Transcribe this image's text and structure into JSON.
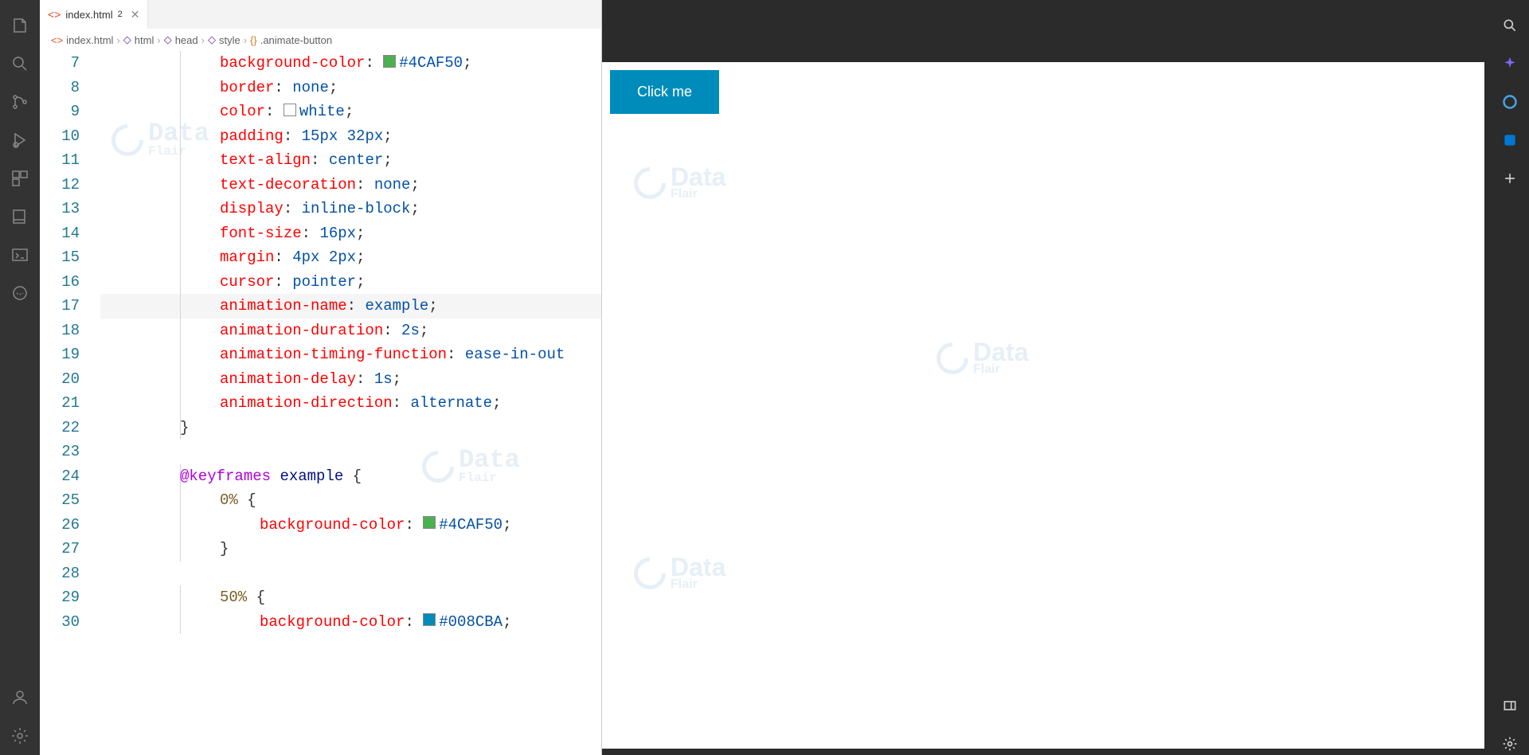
{
  "tab": {
    "filename": "index.html",
    "modified_marker": "2"
  },
  "breadcrumbs": [
    "index.html",
    "html",
    "head",
    "style",
    ".animate-button"
  ],
  "line_start": 7,
  "line_end": 30,
  "highlighted_line": 17,
  "code_lines": [
    {
      "n": 7,
      "indent": 6,
      "tokens": [
        [
          "prop",
          "background-color"
        ],
        [
          "punct",
          ": "
        ],
        [
          "swatch",
          "#4CAF50"
        ],
        [
          "val",
          "#4CAF50"
        ],
        [
          "punct",
          ";"
        ]
      ]
    },
    {
      "n": 8,
      "indent": 6,
      "tokens": [
        [
          "prop",
          "border"
        ],
        [
          "punct",
          ": "
        ],
        [
          "val",
          "none"
        ],
        [
          "punct",
          ";"
        ]
      ]
    },
    {
      "n": 9,
      "indent": 6,
      "tokens": [
        [
          "prop",
          "color"
        ],
        [
          "punct",
          ": "
        ],
        [
          "swatch",
          "#ffffff"
        ],
        [
          "val",
          "white"
        ],
        [
          "punct",
          ";"
        ]
      ]
    },
    {
      "n": 10,
      "indent": 6,
      "tokens": [
        [
          "prop",
          "padding"
        ],
        [
          "punct",
          ": "
        ],
        [
          "val",
          "15px 32px"
        ],
        [
          "punct",
          ";"
        ]
      ]
    },
    {
      "n": 11,
      "indent": 6,
      "tokens": [
        [
          "prop",
          "text-align"
        ],
        [
          "punct",
          ": "
        ],
        [
          "val",
          "center"
        ],
        [
          "punct",
          ";"
        ]
      ]
    },
    {
      "n": 12,
      "indent": 6,
      "tokens": [
        [
          "prop",
          "text-decoration"
        ],
        [
          "punct",
          ": "
        ],
        [
          "val",
          "none"
        ],
        [
          "punct",
          ";"
        ]
      ]
    },
    {
      "n": 13,
      "indent": 6,
      "tokens": [
        [
          "prop",
          "display"
        ],
        [
          "punct",
          ": "
        ],
        [
          "val",
          "inline-block"
        ],
        [
          "punct",
          ";"
        ]
      ]
    },
    {
      "n": 14,
      "indent": 6,
      "tokens": [
        [
          "prop",
          "font-size"
        ],
        [
          "punct",
          ": "
        ],
        [
          "val",
          "16px"
        ],
        [
          "punct",
          ";"
        ]
      ]
    },
    {
      "n": 15,
      "indent": 6,
      "tokens": [
        [
          "prop",
          "margin"
        ],
        [
          "punct",
          ": "
        ],
        [
          "val",
          "4px 2px"
        ],
        [
          "punct",
          ";"
        ]
      ]
    },
    {
      "n": 16,
      "indent": 6,
      "tokens": [
        [
          "prop",
          "cursor"
        ],
        [
          "punct",
          ": "
        ],
        [
          "val",
          "pointer"
        ],
        [
          "punct",
          ";"
        ]
      ]
    },
    {
      "n": 17,
      "indent": 6,
      "tokens": [
        [
          "prop",
          "animation-name"
        ],
        [
          "punct",
          ": "
        ],
        [
          "val",
          "example"
        ],
        [
          "punct",
          ";"
        ]
      ]
    },
    {
      "n": 18,
      "indent": 6,
      "tokens": [
        [
          "prop",
          "animation-duration"
        ],
        [
          "punct",
          ": "
        ],
        [
          "val",
          "2s"
        ],
        [
          "punct",
          ";"
        ]
      ]
    },
    {
      "n": 19,
      "indent": 6,
      "tokens": [
        [
          "prop",
          "animation-timing-function"
        ],
        [
          "punct",
          ": "
        ],
        [
          "val",
          "ease-in-out"
        ]
      ]
    },
    {
      "n": 20,
      "indent": 6,
      "tokens": [
        [
          "prop",
          "animation-delay"
        ],
        [
          "punct",
          ": "
        ],
        [
          "val",
          "1s"
        ],
        [
          "punct",
          ";"
        ]
      ]
    },
    {
      "n": 21,
      "indent": 6,
      "tokens": [
        [
          "prop",
          "animation-direction"
        ],
        [
          "punct",
          ": "
        ],
        [
          "val",
          "alternate"
        ],
        [
          "punct",
          ";"
        ]
      ]
    },
    {
      "n": 22,
      "indent": 5,
      "tokens": [
        [
          "punct",
          "}"
        ]
      ]
    },
    {
      "n": 23,
      "indent": 0,
      "tokens": []
    },
    {
      "n": 24,
      "indent": 5,
      "tokens": [
        [
          "keyword",
          "@keyframes"
        ],
        [
          "punct",
          " "
        ],
        [
          "name",
          "example"
        ],
        [
          "punct",
          " {"
        ]
      ]
    },
    {
      "n": 25,
      "indent": 6,
      "tokens": [
        [
          "func",
          "0%"
        ],
        [
          "punct",
          " {"
        ]
      ]
    },
    {
      "n": 26,
      "indent": 7,
      "tokens": [
        [
          "prop",
          "background-color"
        ],
        [
          "punct",
          ": "
        ],
        [
          "swatch",
          "#4CAF50"
        ],
        [
          "val",
          "#4CAF50"
        ],
        [
          "punct",
          ";"
        ]
      ]
    },
    {
      "n": 27,
      "indent": 6,
      "tokens": [
        [
          "punct",
          "}"
        ]
      ]
    },
    {
      "n": 28,
      "indent": 0,
      "tokens": []
    },
    {
      "n": 29,
      "indent": 6,
      "tokens": [
        [
          "func",
          "50%"
        ],
        [
          "punct",
          " {"
        ]
      ]
    },
    {
      "n": 30,
      "indent": 7,
      "tokens": [
        [
          "prop",
          "background-color"
        ],
        [
          "punct",
          ": "
        ],
        [
          "swatch",
          "#008CBA"
        ],
        [
          "val",
          "#008CBA"
        ],
        [
          "punct",
          ";"
        ]
      ]
    }
  ],
  "preview": {
    "button_label": "Click me",
    "button_bg": "#008CBA"
  },
  "watermark_text": "Data",
  "watermark_sub": "Flair"
}
